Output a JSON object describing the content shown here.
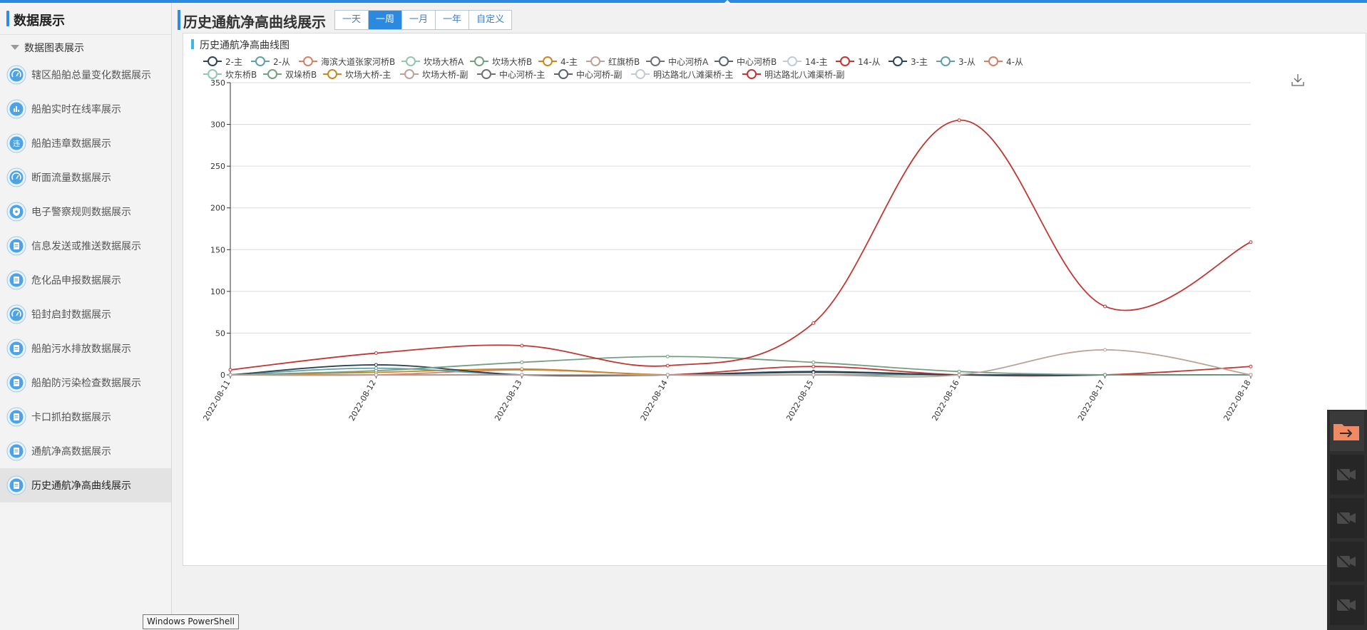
{
  "sidebar": {
    "title": "数据展示",
    "group": "数据图表展示",
    "items": [
      {
        "label": "辖区船舶总量变化数据展示",
        "icon": "gauge-icon"
      },
      {
        "label": "船舶实时在线率展示",
        "icon": "bar-chart-icon"
      },
      {
        "label": "船舶违章数据展示",
        "icon": "violation-icon",
        "glyph": "违"
      },
      {
        "label": "断面流量数据展示",
        "icon": "gauge-icon"
      },
      {
        "label": "电子警察规则数据展示",
        "icon": "shield-icon"
      },
      {
        "label": "信息发送或推送数据展示",
        "icon": "document-icon"
      },
      {
        "label": "危化品申报数据展示",
        "icon": "document-icon"
      },
      {
        "label": "铅封启封数据展示",
        "icon": "gauge-icon"
      },
      {
        "label": "船舶污水排放数据展示",
        "icon": "document-icon"
      },
      {
        "label": "船舶防污染检查数据展示",
        "icon": "document-icon"
      },
      {
        "label": "卡口抓拍数据展示",
        "icon": "document-icon"
      },
      {
        "label": "通航净高数据展示",
        "icon": "document-icon"
      },
      {
        "label": "历史通航净高曲线展示",
        "icon": "document-icon",
        "active": true
      }
    ]
  },
  "header": {
    "title": "历史通航净高曲线展示",
    "ranges": [
      "一天",
      "一周",
      "一月",
      "一年",
      "自定义"
    ],
    "selected_range": "一周"
  },
  "card": {
    "title": "历史通航净高曲线图"
  },
  "tooltip": "Windows PowerShell",
  "colors": {
    "accent": "#2b8ae0",
    "title_bar": "#2f8ce4",
    "card_bar": "#3fb6e6",
    "dock_active": "#f08a65"
  },
  "chart_data": {
    "type": "line",
    "smooth": true,
    "x": [
      "2022-08-11",
      "2022-08-12",
      "2022-08-13",
      "2022-08-14",
      "2022-08-15",
      "2022-08-16",
      "2022-08-17",
      "2022-08-18"
    ],
    "ylim": [
      0,
      350
    ],
    "yticks": [
      0,
      50,
      100,
      150,
      200,
      250,
      300,
      350
    ],
    "grid": "horizontal",
    "legend_position": "top",
    "series": [
      {
        "name": "2-主",
        "color": "#2f4554",
        "values": [
          0,
          12,
          0,
          0,
          3,
          0,
          0,
          0
        ]
      },
      {
        "name": "2-从",
        "color": "#61a0a8",
        "values": [
          0,
          8,
          0,
          0,
          0,
          0,
          0,
          0
        ]
      },
      {
        "name": "海滨大道张家河桥B",
        "color": "#d48265",
        "values": [
          0,
          0,
          6,
          0,
          0,
          0,
          0,
          0
        ]
      },
      {
        "name": "坎场大桥A",
        "color": "#91c7ae",
        "values": [
          0,
          0,
          0,
          0,
          0,
          0,
          0,
          0
        ]
      },
      {
        "name": "坎场大桥B",
        "color": "#749f83",
        "values": [
          0,
          5,
          15,
          22,
          15,
          4,
          0,
          0
        ]
      },
      {
        "name": "4-主",
        "color": "#ca8622",
        "values": [
          0,
          3,
          7,
          0,
          0,
          0,
          0,
          0
        ]
      },
      {
        "name": "红旗桥B",
        "color": "#bda29a",
        "values": [
          0,
          0,
          0,
          0,
          0,
          0,
          30,
          0
        ]
      },
      {
        "name": "中心河桥A",
        "color": "#6e7074",
        "values": [
          0,
          0,
          0,
          0,
          0,
          0,
          0,
          0
        ]
      },
      {
        "name": "中心河桥B",
        "color": "#546570",
        "values": [
          0,
          0,
          0,
          0,
          0,
          0,
          0,
          0
        ]
      },
      {
        "name": "14-主",
        "color": "#c4ccd3",
        "values": [
          0,
          0,
          0,
          0,
          0,
          0,
          0,
          0
        ]
      },
      {
        "name": "14-从",
        "color": "#c23531",
        "values": [
          6,
          26,
          35,
          11,
          62,
          305,
          82,
          159
        ]
      },
      {
        "name": "3-主",
        "color": "#2f4554",
        "values": [
          0,
          0,
          0,
          0,
          4,
          0,
          0,
          0
        ]
      },
      {
        "name": "3-从",
        "color": "#61a0a8",
        "values": [
          0,
          0,
          0,
          0,
          0,
          0,
          0,
          0
        ]
      },
      {
        "name": "4-从",
        "color": "#d48265",
        "values": [
          0,
          0,
          0,
          0,
          0,
          0,
          0,
          0
        ]
      },
      {
        "name": "坎东桥B",
        "color": "#91c7ae",
        "values": [
          0,
          0,
          0,
          0,
          0,
          0,
          0,
          0
        ]
      },
      {
        "name": "双垛桥B",
        "color": "#749f83",
        "values": [
          0,
          0,
          0,
          0,
          0,
          0,
          0,
          0
        ]
      },
      {
        "name": "坎场大桥-主",
        "color": "#ca8622",
        "values": [
          0,
          0,
          0,
          0,
          0,
          0,
          0,
          0
        ]
      },
      {
        "name": "坎场大桥-副",
        "color": "#bda29a",
        "values": [
          0,
          0,
          0,
          0,
          0,
          0,
          0,
          0
        ]
      },
      {
        "name": "中心河桥-主",
        "color": "#6e7074",
        "values": [
          0,
          0,
          0,
          0,
          0,
          0,
          0,
          0
        ]
      },
      {
        "name": "中心河桥-副",
        "color": "#546570",
        "values": [
          0,
          0,
          0,
          0,
          0,
          0,
          0,
          0
        ]
      },
      {
        "name": "明达路北八滩渠桥-主",
        "color": "#c4ccd3",
        "values": [
          0,
          0,
          0,
          0,
          0,
          0,
          0,
          0
        ]
      },
      {
        "name": "明达路北八滩渠桥-副",
        "color": "#c23531",
        "values": [
          0,
          0,
          0,
          0,
          10,
          0,
          0,
          10
        ]
      }
    ]
  }
}
